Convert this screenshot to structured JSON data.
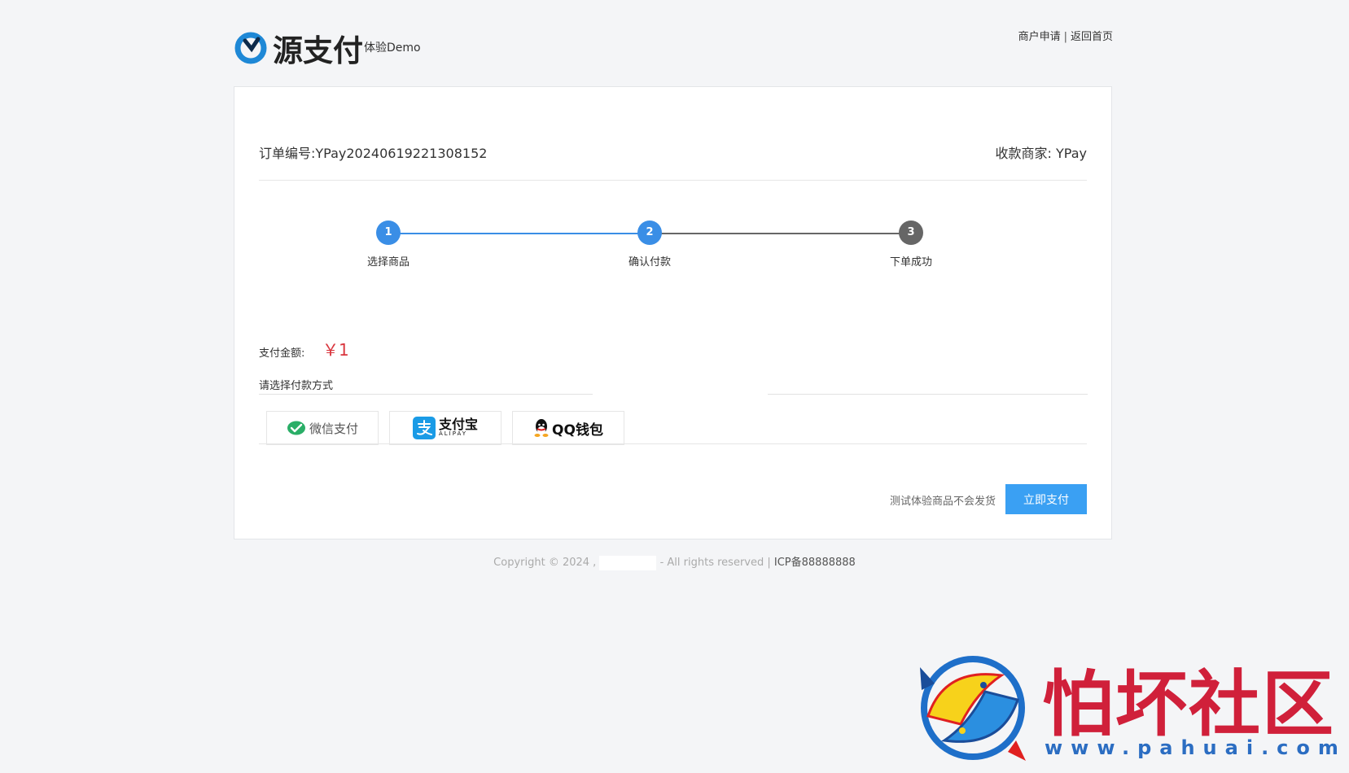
{
  "header": {
    "logo_text": "源支付",
    "logo_sub": "体验Demo",
    "links": [
      "商户申请",
      "返回首页"
    ],
    "link_separator": "|"
  },
  "order": {
    "order_no_label": "订单编号:YPay20240619221308152",
    "merchant_label": "收款商家: YPay"
  },
  "steps": [
    {
      "num": "1",
      "label": "选择商品",
      "state": "done"
    },
    {
      "num": "2",
      "label": "确认付款",
      "state": "active"
    },
    {
      "num": "3",
      "label": "下单成功",
      "state": "pending"
    }
  ],
  "payment": {
    "amount_label": "支付金额:",
    "amount_value": "￥1",
    "choose_label": "请选择付款方式",
    "methods": [
      {
        "name": "微信支付",
        "icon": "wechat-icon"
      },
      {
        "name": "支付宝",
        "sub": "ALIPAY",
        "icon": "alipay-icon"
      },
      {
        "name": "QQ钱包",
        "icon": "qq-icon"
      }
    ],
    "note": "测试体验商品不会发货",
    "submit_label": "立即支付"
  },
  "footer": {
    "copyright": "Copyright © 2024 ,",
    "rights": "- All rights reserved |",
    "icp": "ICP备88888888"
  },
  "watermark": {
    "text": "怕坏社区",
    "url": "www.pahuai.com"
  },
  "colors": {
    "primary": "#3aa0f3",
    "step_active": "#3a8ee6",
    "step_pending": "#666666",
    "amount": "#d9363e",
    "watermark_red": "#d0203a",
    "watermark_blue": "#2b6dc2"
  }
}
